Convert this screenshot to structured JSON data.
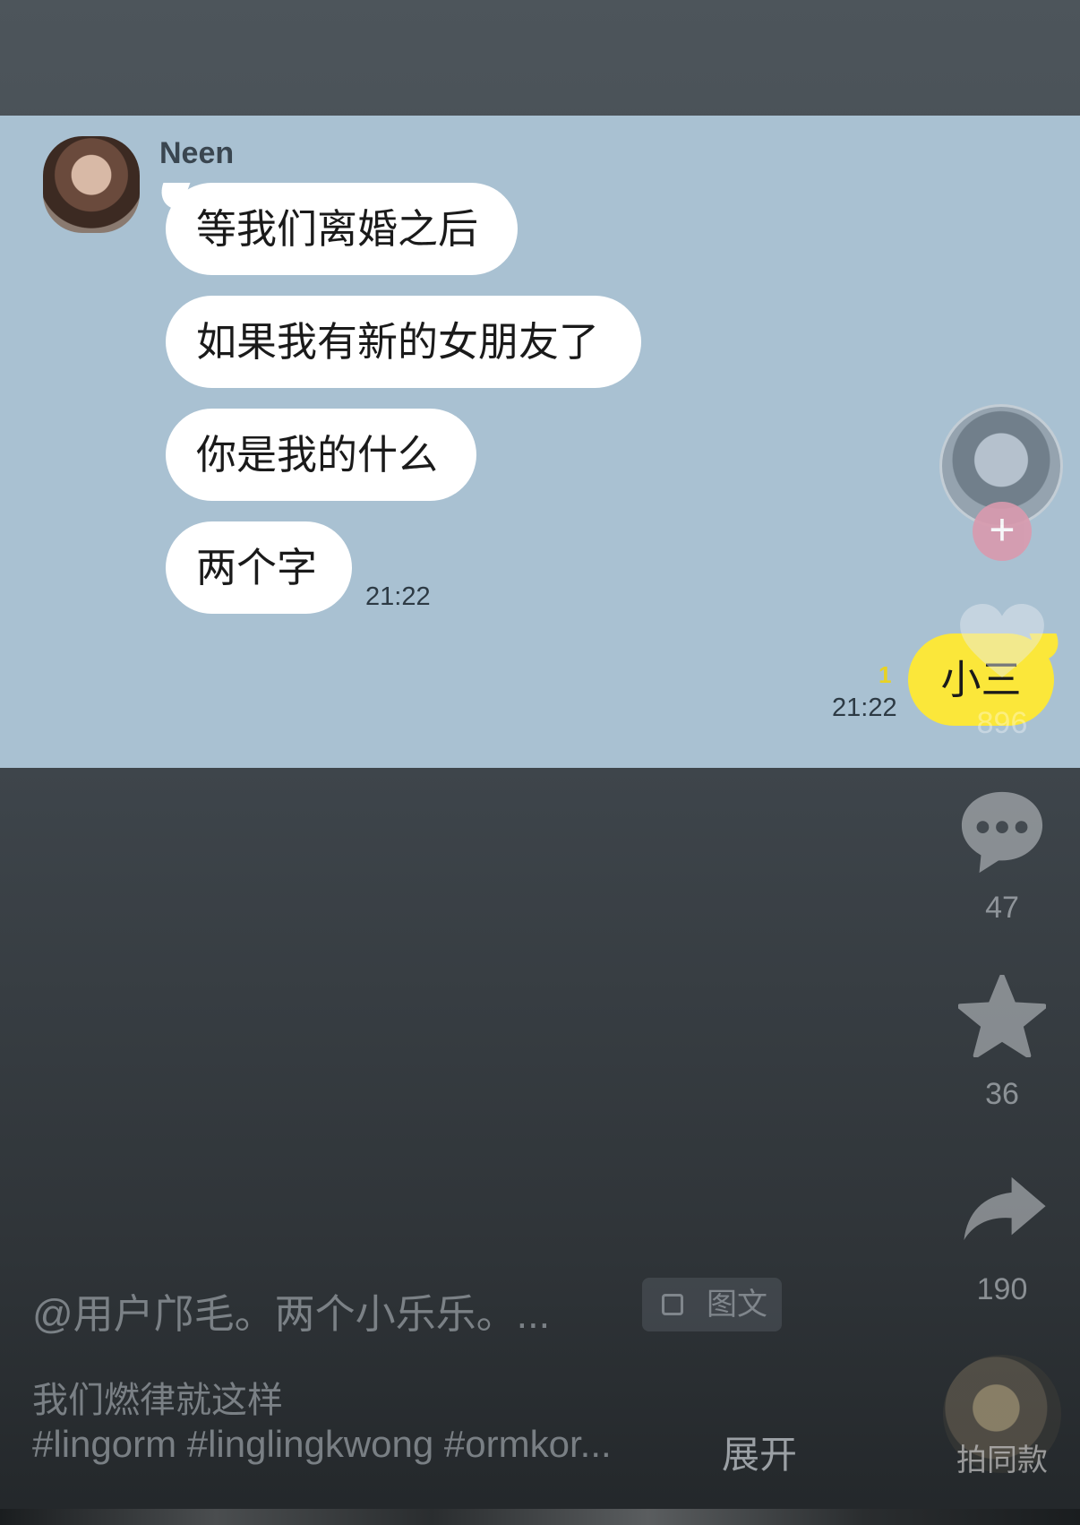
{
  "chat": {
    "sender_name": "Neen",
    "messages": [
      {
        "text": "等我们离婚之后"
      },
      {
        "text": "如果我有新的女朋友了"
      },
      {
        "text": "你是我的什么"
      },
      {
        "text": "两个字"
      }
    ],
    "incoming_time": "21:22",
    "reply": {
      "text": "小三",
      "time": "21:22",
      "unread_count": "1"
    }
  },
  "rail": {
    "follow_label": "+",
    "like_count": "896",
    "comment_count": "47",
    "favorite_count": "36",
    "share_count": "190",
    "disc_label": "拍同款"
  },
  "caption": {
    "author_line": "@用户邝毛。两个小乐乐。...",
    "chip_label": "图文",
    "description": "我们燃律就这样",
    "hashtags": "#lingorm #linglingkwong #ormkor...",
    "expand_label": "展开"
  },
  "colors": {
    "chat_background": "#a9c1d2",
    "incoming_bubble": "#ffffff",
    "outgoing_bubble": "#fbe73a",
    "follow_button": "#d99aae"
  }
}
